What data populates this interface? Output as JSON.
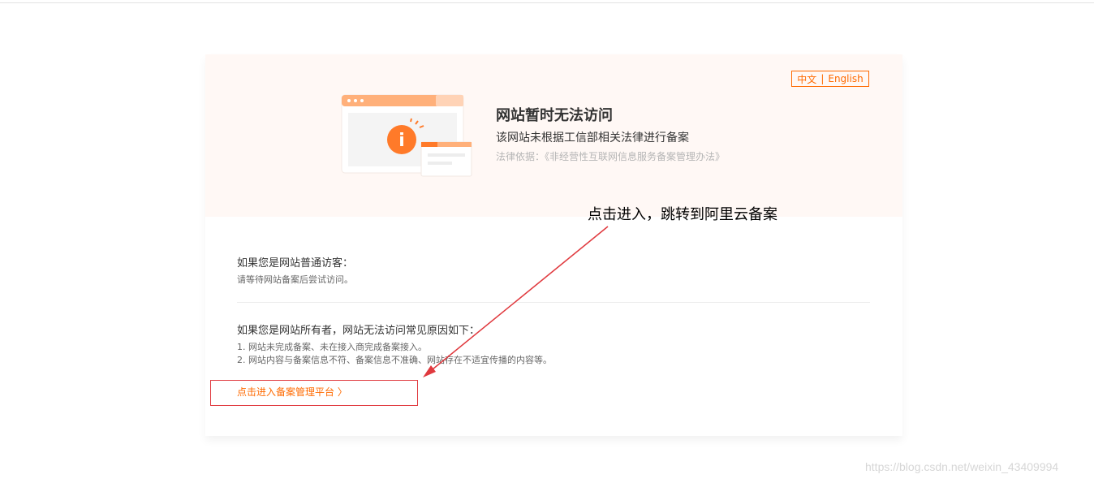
{
  "lang": {
    "zh": "中文",
    "separator": "|",
    "en": "English"
  },
  "header": {
    "title": "网站暂时无法访问",
    "subtitle": "该网站未根据工信部相关法律进行备案",
    "legal_basis": "法律依据：《非经营性互联网信息服务备案管理办法》"
  },
  "illustration": {
    "icon": "info-icon",
    "symbol": "i"
  },
  "visitor": {
    "heading": "如果您是网站普通访客：",
    "text": "请等待网站备案后尝试访问。"
  },
  "owner": {
    "heading": "如果您是网站所有者，网站无法访问常见原因如下：",
    "reasons": [
      "1. 网站未完成备案、未在接入商完成备案接入。",
      "2. 网站内容与备案信息不符、备案信息不准确、网站存在不适宜传播的内容等。"
    ]
  },
  "cta": {
    "label": "点击进入备案管理平台",
    "chevron": "〉"
  },
  "annotation": {
    "text": "点击进入，跳转到阿里云备案",
    "color": "#e0393e"
  },
  "watermark": "https://blog.csdn.net/weixin_43409994",
  "colors": {
    "accent": "#ff6a00",
    "banner_bg": "#fff8f5"
  }
}
